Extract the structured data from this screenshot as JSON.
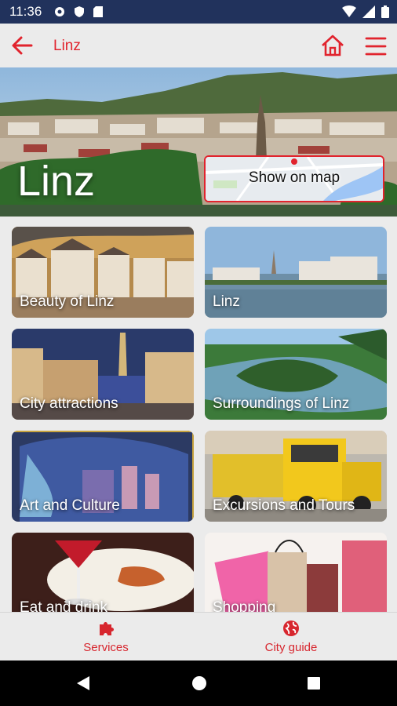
{
  "status_bar": {
    "time": "11:36"
  },
  "app_bar": {
    "title": "Linz"
  },
  "hero": {
    "city_name": "Linz",
    "map_button_label": "Show on map"
  },
  "tiles": [
    {
      "label": "Beauty of Linz"
    },
    {
      "label": "Linz"
    },
    {
      "label": "City attractions"
    },
    {
      "label": "Surroundings of Linz"
    },
    {
      "label": "Art and Culture"
    },
    {
      "label": "Excursions and Tours"
    },
    {
      "label": "Eat and drink"
    },
    {
      "label": "Shopping"
    }
  ],
  "bottom_nav": {
    "services_label": "Services",
    "city_guide_label": "City guide"
  },
  "colors": {
    "accent": "#e1232d",
    "status_bar": "#21325c",
    "background": "#ebebeb"
  }
}
